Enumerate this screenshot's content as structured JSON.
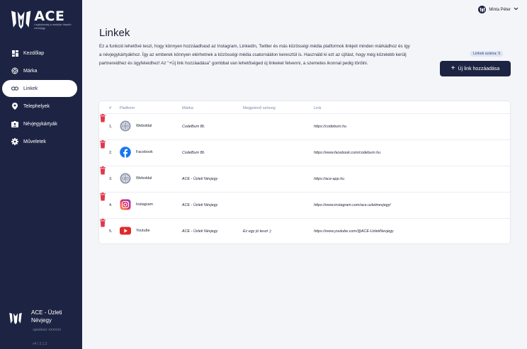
{
  "brand": {
    "name": "ACE",
    "tagline": "Legbolondaj a mobiljer ikaolfn nevejegy"
  },
  "nav": [
    {
      "label": "Kezdőlap",
      "icon": "dashboard-icon"
    },
    {
      "label": "Márka",
      "icon": "brand-icon"
    },
    {
      "label": "Linkek",
      "icon": "link-icon",
      "active": true
    },
    {
      "label": "Telephelyek",
      "icon": "location-pin-icon"
    },
    {
      "label": "Névjegykártyák",
      "icon": "contact-card-icon"
    },
    {
      "label": "Műveletek",
      "icon": "gear-icon"
    }
  ],
  "org": {
    "name": "ACE - Üzleti Névjegy",
    "id": "Ajánlókód: XXXXXX"
  },
  "version": "v4 / 2.1.2",
  "user": {
    "name": "Minta Péter"
  },
  "page": {
    "title": "Linkek",
    "description": "Ez a funkció lehetővé teszi, hogy könnyen hozzáadhasd az Instagram, LinkedIn, Twitter és más közösségi média platformok linkjeit minden márkádhoz és így a névjegykártyákhoz. Így az emberek könnyen elérhetnek a közösségi média csatornáidon keresztül is. Használd ki ezt az újítást, hogy még közelebb kerülj partnereidhez és ügyfeleidhez! Az \"+Új link hozzáadása\" gombbal van lehetőséged új linkeket felvenni, a szemetes ikonnal pedig törölni.",
    "count_label": "Linkek száma: 5",
    "add_button": "Új link hozzáadása"
  },
  "table": {
    "headers": {
      "num": "#",
      "platform": "Platform",
      "brand": "Márka",
      "text": "Megjelenő szöveg",
      "link": "Link"
    },
    "rows": [
      {
        "num": "1.",
        "platform": "Weboldal",
        "icon": "globe-icon",
        "brand": "CodeBurn Bt.",
        "text": "",
        "link": "https://codeburn.hu"
      },
      {
        "num": "2.",
        "platform": "Facebook",
        "icon": "facebook-icon",
        "brand": "CodeBurn Bt.",
        "text": "",
        "link": "https://www.facebook.com/codeburn.hu"
      },
      {
        "num": "3.",
        "platform": "Weboldal",
        "icon": "globe-icon",
        "brand": "ACE - Üzleti Névjegy",
        "text": "",
        "link": "https://ace-app.hu"
      },
      {
        "num": "4.",
        "platform": "Instagram",
        "icon": "instagram-icon",
        "brand": "ACE - Üzleti Névjegy",
        "text": "",
        "link": "https://www.instagram.com/ace.uzletinevjegy/"
      },
      {
        "num": "5.",
        "platform": "Youtube",
        "icon": "youtube-icon",
        "brand": "ACE - Üzleti Névjegy",
        "text": "Ez egy jó teszt :)",
        "link": "https://www.youtube.com/@ACE-UzletiNevjegy"
      }
    ]
  },
  "colors": {
    "sidebar": "#1d2443",
    "accent": "#1d2443",
    "delete": "#e0384b",
    "background": "#f4f5f8"
  }
}
